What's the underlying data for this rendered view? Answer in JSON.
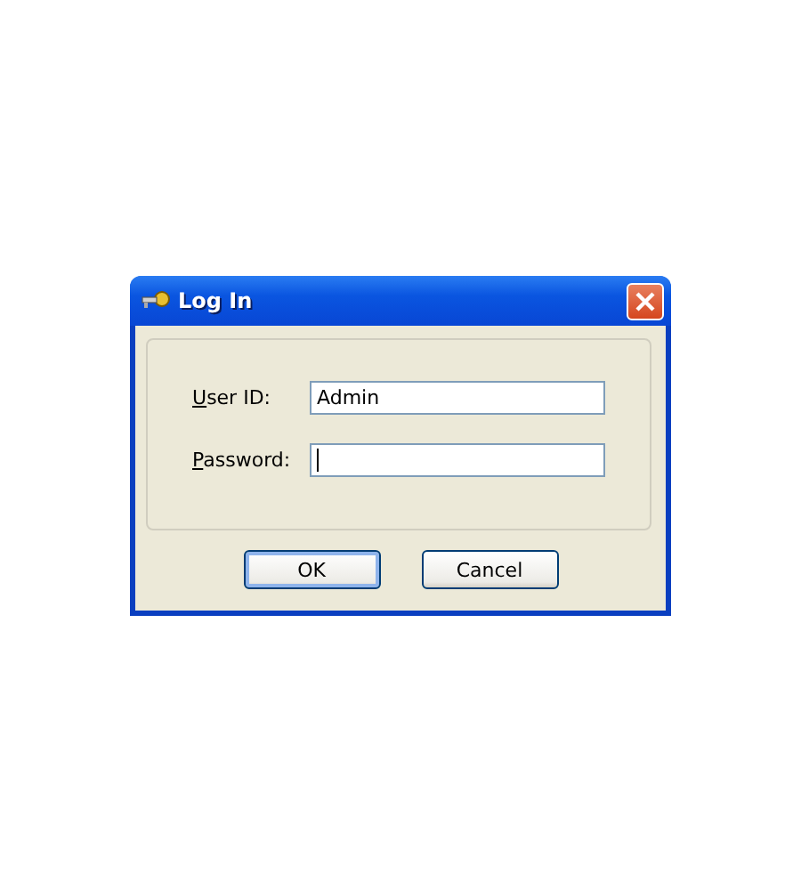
{
  "window": {
    "title": "Log In"
  },
  "fields": [
    {
      "label": "User ID:",
      "value": "Admin",
      "focused": false
    },
    {
      "label": "Password:",
      "focused": true
    }
  ],
  "buttons": [
    {
      "label": "OK",
      "default": true
    },
    {
      "label": "Cancel",
      "default": false
    }
  ]
}
